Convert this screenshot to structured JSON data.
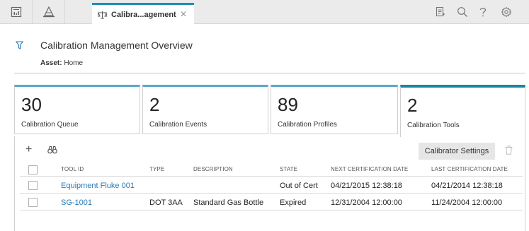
{
  "tabs": {
    "icons": [
      "dashboard-icon",
      "asset-hierarchy-icon"
    ],
    "active_label": "Calibra...agement",
    "active_icon": "calibration-icon",
    "close_glyph": "✕"
  },
  "toolbar_icons": [
    "report-icon",
    "search-icon",
    "help-icon",
    "settings-icon"
  ],
  "header": {
    "title": "Calibration Management Overview",
    "asset_label": "Asset:",
    "asset_value": "Home"
  },
  "tiles": [
    {
      "value": "30",
      "label": "Calibration Queue"
    },
    {
      "value": "2",
      "label": "Calibration Events"
    },
    {
      "value": "89",
      "label": "Calibration Profiles"
    },
    {
      "value": "2",
      "label": "Calibration Tools"
    }
  ],
  "panel": {
    "add_glyph": "+",
    "settings_label": "Calibrator Settings"
  },
  "table": {
    "columns": [
      "TOOL ID",
      "TYPE",
      "DESCRIPTION",
      "STATE",
      "NEXT CERTIFICATION DATE",
      "LAST CERTIFICATION DATE"
    ],
    "rows": [
      {
        "tool_id": "Equipment Fluke 001",
        "type": "",
        "description": "",
        "state": "Out of Cert",
        "next_cert": "04/21/2015 12:38:18",
        "last_cert": "04/21/2014 12:38:18"
      },
      {
        "tool_id": "SG-1001",
        "type": "DOT 3AA",
        "description": "Standard Gas Bottle",
        "state": "Expired",
        "next_cert": "12/31/2004 12:00:00",
        "last_cert": "11/24/2004 12:00:00"
      }
    ]
  },
  "colors": {
    "accent": "#17869f",
    "link": "#2a7ab6",
    "tile_border": "#5aa9c8"
  }
}
